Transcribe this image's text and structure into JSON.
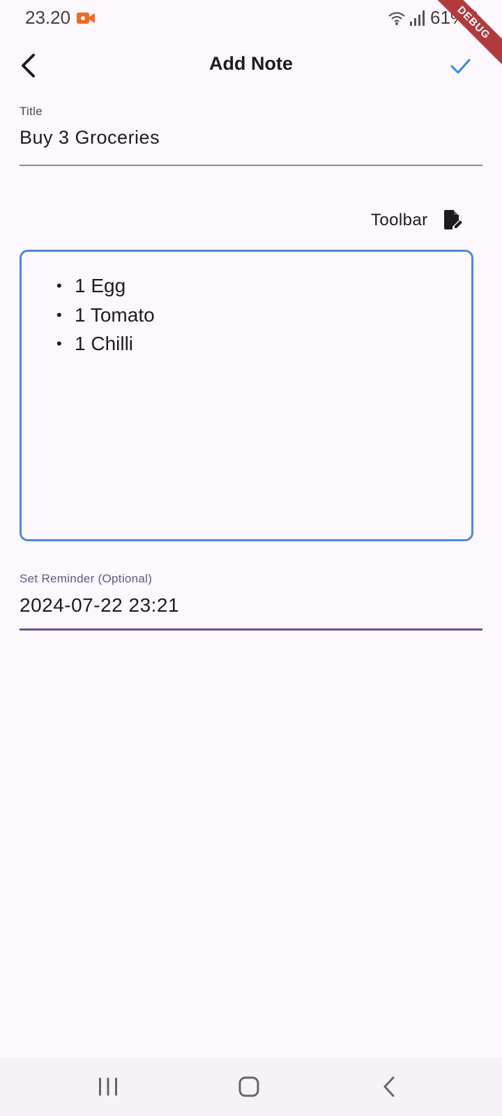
{
  "status_bar": {
    "time": "23.20",
    "battery": "61%",
    "debug_banner": "DEBUG",
    "icons": [
      "screen-record-icon",
      "wifi-icon",
      "signal-icon",
      "battery-icon"
    ]
  },
  "app_bar": {
    "title": "Add Note",
    "back_icon": "chevron-left-icon",
    "save_icon": "check-icon"
  },
  "title_field": {
    "label": "Title",
    "value": "Buy 3 Groceries"
  },
  "toolbar_toggle": {
    "label": "Toolbar",
    "icon": "edit-document-icon"
  },
  "editor": {
    "items": [
      "1 Egg",
      "1 Tomato",
      "1 Chilli"
    ]
  },
  "reminder_field": {
    "label": "Set Reminder (Optional)",
    "value": "2024-07-22 23:21"
  },
  "nav_bar": {
    "buttons": [
      "recent-apps-icon",
      "home-icon",
      "back-icon"
    ]
  },
  "colors": {
    "background": "#fdf7fe",
    "accent": "#4a88e4",
    "primary": "#65558f",
    "check": "#2f8fd8",
    "record": "#f26a1b",
    "debug": "#b33a3a"
  }
}
